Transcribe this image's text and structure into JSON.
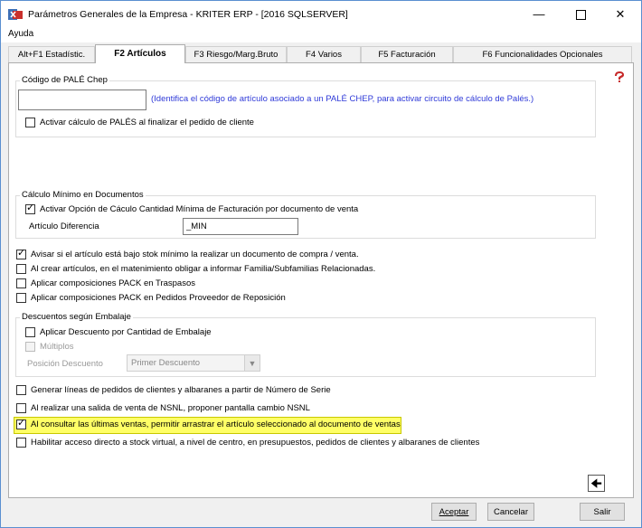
{
  "window": {
    "title": "Parámetros Generales de la Empresa - KRITER ERP - [2016 SQLSERVER]"
  },
  "menu": {
    "ayuda": "Ayuda"
  },
  "tabs": [
    {
      "label": "Alt+F1 Estadístic."
    },
    {
      "label": "F2 Artículos"
    },
    {
      "label": "F3 Riesgo/Marg.Bruto"
    },
    {
      "label": "F4 Varios"
    },
    {
      "label": "F5 Facturación"
    },
    {
      "label": "F6 Funcionalidades Opcionales"
    }
  ],
  "pale": {
    "group_label": "Código de PALÉ Chep",
    "input_value": "",
    "info_text": "(Identifica el código de artículo asociado a un PALÉ CHEP, para activar circuito de cálculo de Palés.)",
    "activar_label": "Activar cálculo de PALÉS al finalizar el pedido de cliente",
    "activar_checked": false
  },
  "calculo": {
    "group_label": "Cálculo Mínimo en Documentos",
    "activar_label": "Activar Opción de Cáculo Cantidad Mínima de Facturación por documento de venta",
    "activar_checked": true,
    "articulo_label": "Artículo Diferencia",
    "articulo_value": "_MIN"
  },
  "options1": [
    {
      "label": "Avisar si el artículo está bajo stok mínimo la realizar un documento de compra / venta.",
      "checked": true
    },
    {
      "label": "Al crear artículos, en el matenimiento obligar a informar Familia/Subfamilias Relacionadas.",
      "checked": false
    },
    {
      "label": "Aplicar composiciones PACK en Traspasos",
      "checked": false
    },
    {
      "label": "Aplicar composiciones PACK en Pedidos Proveedor de Reposición",
      "checked": false
    }
  ],
  "descuentos": {
    "group_label": "Descuentos según Embalaje",
    "aplicar_label": "Aplicar Descuento por Cantidad de Embalaje",
    "aplicar_checked": false,
    "multiplos_label": "Múltiplos",
    "multiplos_checked": false,
    "posicion_label": "Posición Descuento",
    "posicion_value": "Primer Descuento"
  },
  "options2": [
    {
      "label": "Generar líneas de pedidos de clientes y albaranes a partir de Número de Serie",
      "checked": false
    },
    {
      "label": "Al realizar una salida de venta de NSNL, proponer pantalla cambio  NSNL",
      "checked": false
    },
    {
      "label": "Al consultar las últimas ventas, permitir arrastrar el artículo seleccionado al documento de ventas",
      "checked": true
    },
    {
      "label": "Habilitar acceso directo a stock virtual, a nivel de centro, en presupuestos, pedidos de clientes y albaranes de clientes",
      "checked": false
    }
  ],
  "buttons": {
    "aceptar": "Aceptar",
    "cancelar": "Cancelar",
    "salir": "Salir"
  },
  "colors": {
    "highlight": "#ffff66",
    "info_text": "#2f3ad8",
    "window_border": "#5a8fd0"
  }
}
